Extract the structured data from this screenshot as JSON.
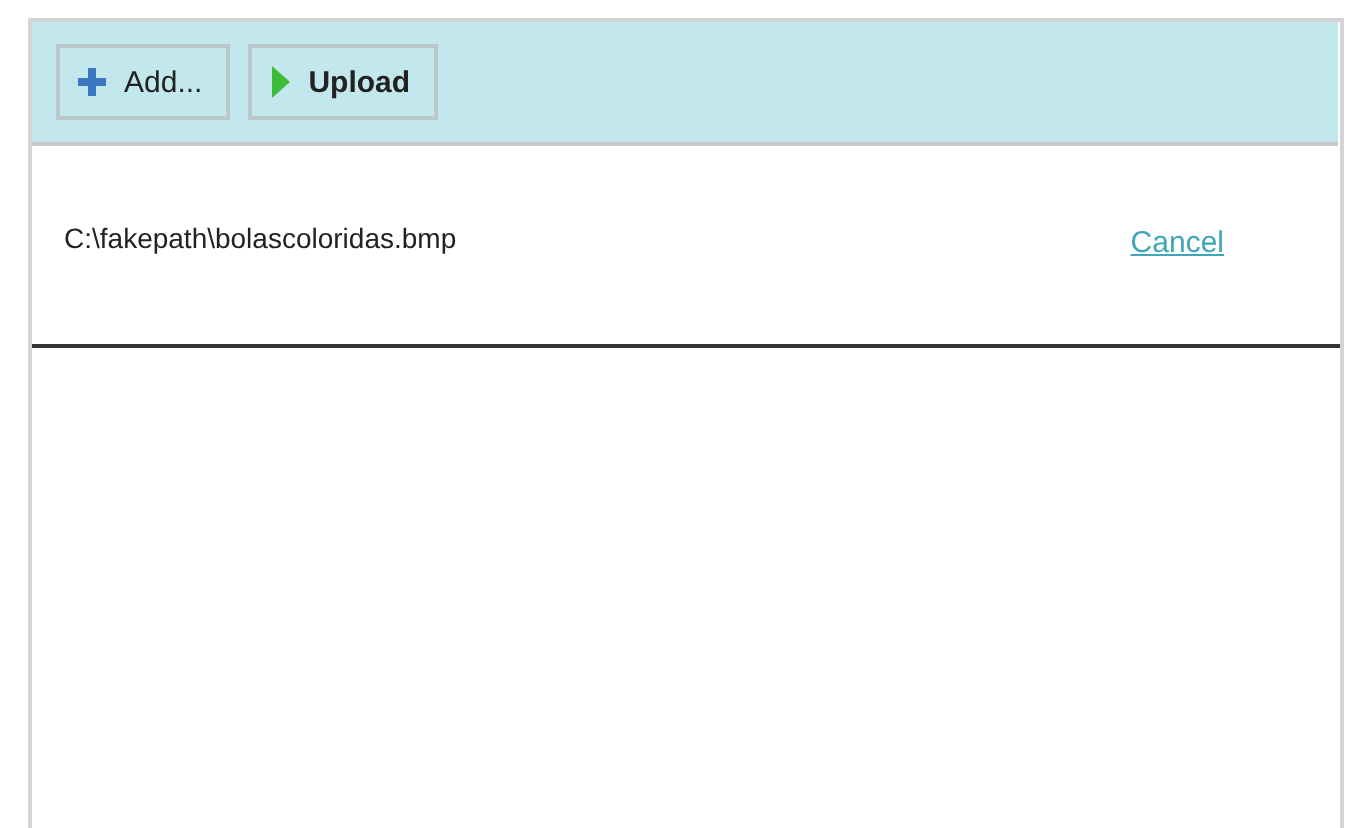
{
  "toolbar": {
    "buttons": [
      {
        "kind": "add",
        "label": "Add..."
      },
      {
        "kind": "upload",
        "label": "Upload"
      }
    ]
  },
  "files": [
    {
      "path": "C:\\fakepath\\bolascoloridas.bmp",
      "action": "Cancel"
    }
  ]
}
